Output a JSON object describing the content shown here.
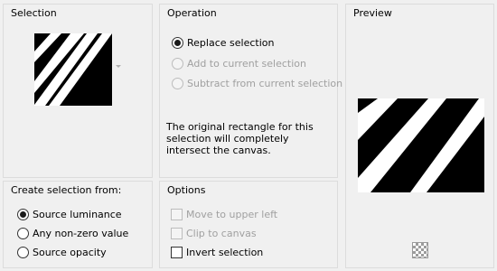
{
  "selection": {
    "title": "Selection"
  },
  "operation": {
    "title": "Operation",
    "replace": {
      "label": "Replace selection",
      "checked": true,
      "enabled": true
    },
    "add": {
      "label": "Add to current selection",
      "checked": false,
      "enabled": false
    },
    "subtract": {
      "label": "Subtract from current selection",
      "checked": false,
      "enabled": false
    },
    "info": "The original rectangle for this selection will completely intersect the canvas."
  },
  "preview": {
    "title": "Preview"
  },
  "create_from": {
    "title": "Create selection from:",
    "source_luminance": {
      "label": "Source luminance",
      "checked": true
    },
    "any_nonzero": {
      "label": "Any non-zero value",
      "checked": false
    },
    "source_opacity": {
      "label": "Source opacity",
      "checked": false
    }
  },
  "options": {
    "title": "Options",
    "move_upper_left": {
      "label": "Move to upper left",
      "checked": false,
      "enabled": false
    },
    "clip_canvas": {
      "label": "Clip to canvas",
      "checked": false,
      "enabled": false
    },
    "invert": {
      "label": "Invert selection",
      "checked": false,
      "enabled": true
    }
  },
  "colors": {
    "background": "#f0f0f0",
    "group_border": "#dcdcdc",
    "disabled_text": "#a0a0a0",
    "image_black": "#000000",
    "image_white": "#ffffff"
  },
  "icons": {
    "dropdown": "chevron-down-icon",
    "transparency": "checkerboard-icon"
  }
}
